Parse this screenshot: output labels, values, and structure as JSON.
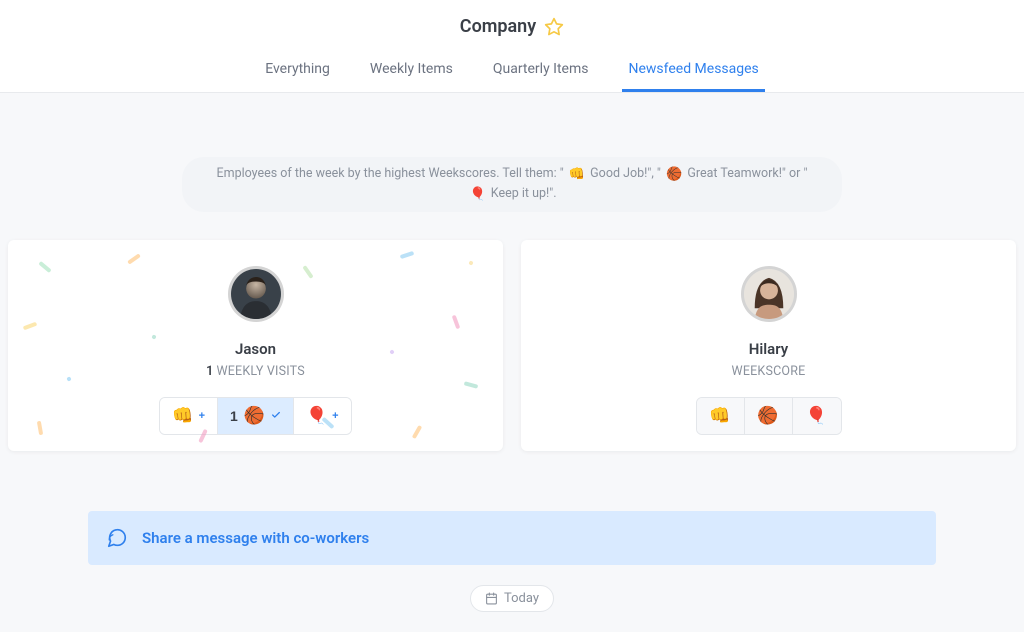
{
  "header": {
    "title": "Company"
  },
  "tabs": [
    {
      "label": "Everything",
      "active": false
    },
    {
      "label": "Weekly Items",
      "active": false
    },
    {
      "label": "Quarterly Items",
      "active": false
    },
    {
      "label": "Newsfeed Messages",
      "active": true
    }
  ],
  "banner": {
    "pre": "Employees of the week by the highest Weekscores. Tell them: \"",
    "p1_emoji": "👊",
    "p1": " Good Job!\", \"",
    "p2_emoji": "🏀",
    "p2": " Great Teamwork!\" or \"",
    "p3_emoji": "🎈",
    "p3": " Keep it up!\"."
  },
  "cards": [
    {
      "name": "Jason",
      "metric_count": "1",
      "metric_label": "WEEKLY VISITS",
      "reactions": {
        "fist": {
          "emoji": "👊",
          "plus": "+"
        },
        "basketball": {
          "emoji": "🏀",
          "count": "1",
          "selected": true
        },
        "balloon": {
          "emoji": "🎈",
          "plus": "+"
        }
      },
      "confetti": true
    },
    {
      "name": "Hilary",
      "metric_count": "",
      "metric_label": "WEEKSCORE",
      "reactions": {
        "fist": {
          "emoji": "👊"
        },
        "basketball": {
          "emoji": "🏀"
        },
        "balloon": {
          "emoji": "🎈"
        }
      },
      "muted": true
    }
  ],
  "share": {
    "text": "Share a message with co-workers"
  },
  "today": {
    "label": "Today"
  }
}
